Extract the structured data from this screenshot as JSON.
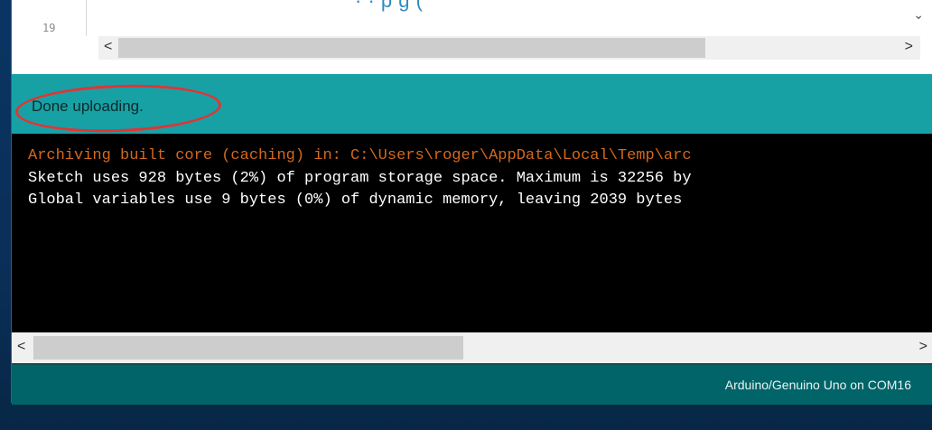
{
  "editor": {
    "line_number": "19",
    "top_text": "  ·     ·                         p       g (",
    "dropdown_icon": "chevron-down-icon",
    "scroll_left": "<",
    "scroll_right": ">"
  },
  "status": {
    "message": "Done uploading."
  },
  "console": {
    "lines": [
      "Archiving built core (caching) in: C:\\Users\\roger\\AppData\\Local\\Temp\\arc",
      "Sketch uses 928 bytes (2%) of program storage space. Maximum is 32256 by",
      "Global variables use 9 bytes (0%) of dynamic memory, leaving 2039 bytes"
    ],
    "scroll_left": "<",
    "scroll_right": ">"
  },
  "footer": {
    "board_info": "Arduino/Genuino Uno on COM16"
  },
  "colors": {
    "status_bar": "#17a1a5",
    "footer_bar": "#006468",
    "console_bg": "#000000",
    "warning_text": "#d2691e",
    "annotation_circle": "#e23434"
  }
}
